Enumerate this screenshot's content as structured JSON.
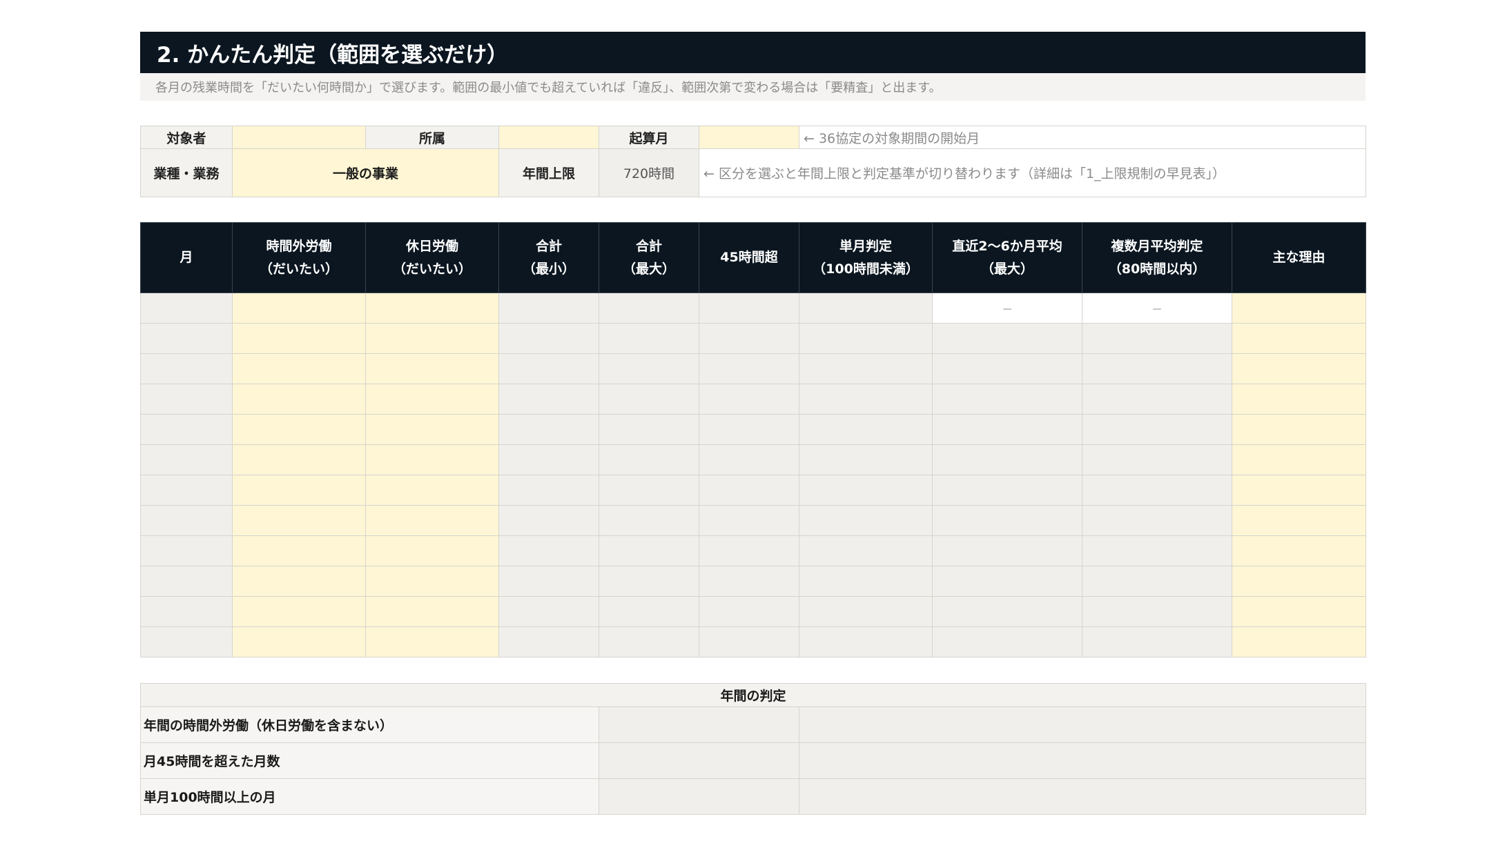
{
  "header": {
    "title": "2. かんたん判定（範囲を選ぶだけ）",
    "subtitle": "各月の残業時間を「だいたい何時間か」で選びます。範囲の最小値でも超えていれば「違反」、範囲次第で変わる場合は「要精査」と出ます。"
  },
  "info": {
    "target_label": "対象者",
    "target_value": "",
    "dept_label": "所属",
    "dept_value": "",
    "start_month_label": "起算月",
    "start_month_value": "",
    "start_month_note": "← 36協定の対象期間の開始月",
    "industry_label": "業種・業務",
    "industry_value": "一般の事業",
    "annual_limit_label": "年間上限",
    "annual_limit_value": "720時間",
    "industry_note": "← 区分を選ぶと年間上限と判定基準が切り替わります（詳細は「1_上限規制の早見表」）"
  },
  "table": {
    "headers": {
      "month": "月",
      "overtime_1": "時間外労働",
      "overtime_2": "（だいたい）",
      "holiday_1": "休日労働",
      "holiday_2": "（だいたい）",
      "total_min_1": "合計",
      "total_min_2": "（最小）",
      "total_max_1": "合計",
      "total_max_2": "（最大）",
      "over45": "45時間超",
      "monthly_1": "単月判定",
      "monthly_2": "（100時間未満）",
      "recent_1": "直近2～6か月平均",
      "recent_2": "（最大）",
      "multi_1": "複数月平均判定",
      "multi_2": "（80時間以内）",
      "reason": "主な理由"
    },
    "first_row_dash": "－"
  },
  "annual": {
    "title": "年間の判定",
    "rows": [
      {
        "label": "年間の時間外労働（休日労働を含まない）",
        "value": "",
        "judgement": ""
      },
      {
        "label": "月45時間を超えた月数",
        "value": "",
        "judgement": ""
      },
      {
        "label": "単月100時間以上の月",
        "value": "",
        "judgement": ""
      }
    ]
  },
  "colors": {
    "header_bg": "#0b1620",
    "input_yellow": "#fef6d4",
    "calc_gray": "#f0efec"
  }
}
